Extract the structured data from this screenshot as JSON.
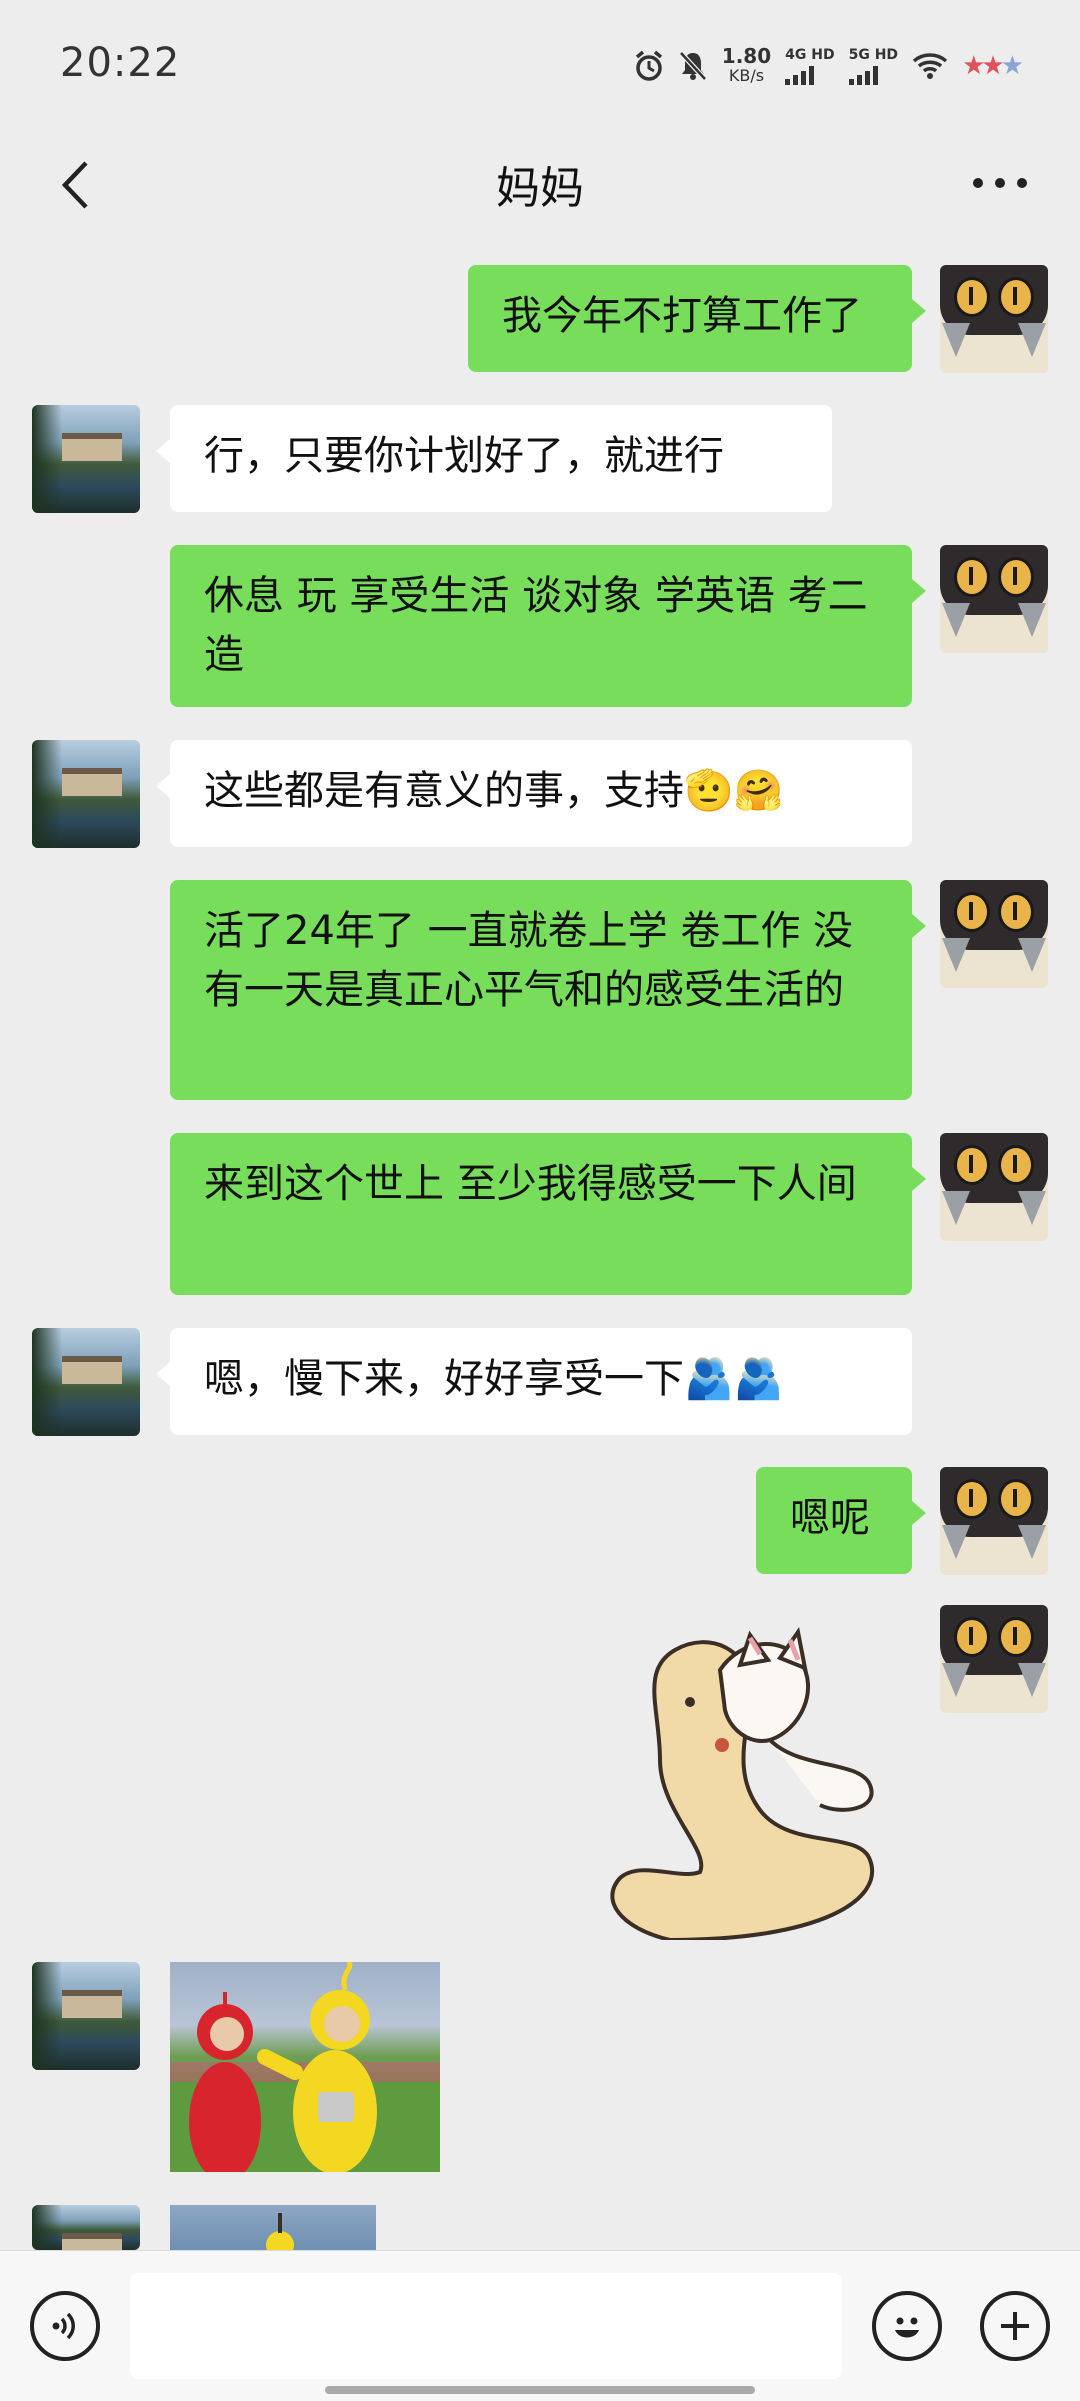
{
  "status_bar": {
    "time": "20:22",
    "net_speed_value": "1.80",
    "net_speed_unit": "KB/s",
    "sim1_label": "4G HD",
    "sim2_label": "5G HD",
    "icons": [
      "alarm-icon",
      "mute-icon",
      "signal-icon",
      "wifi-icon",
      "star-rating-icon"
    ]
  },
  "header": {
    "title": "妈妈",
    "back_icon": "chevron-left-icon",
    "more_icon": "more-dots-icon"
  },
  "messages": [
    {
      "sender": "me",
      "type": "text",
      "text": "我今年不打算工作了"
    },
    {
      "sender": "mom",
      "type": "text",
      "text": "行，只要你计划好了，就进行"
    },
    {
      "sender": "me",
      "type": "text",
      "text": "休息  玩   享受生活   谈对象  学英语   考二造"
    },
    {
      "sender": "mom",
      "type": "text",
      "text": "这些都是有意义的事，支持🫡🤗"
    },
    {
      "sender": "me",
      "type": "text",
      "text": "活了24年了  一直就卷上学 卷工作  没有一天是真正心平气和的感受生活的"
    },
    {
      "sender": "me",
      "type": "text",
      "text": "来到这个世上 至少我得感受一下人间"
    },
    {
      "sender": "mom",
      "type": "text",
      "text": "嗯，慢下来，好好享受一下🫂🫂"
    },
    {
      "sender": "me",
      "type": "text",
      "text": "嗯呢"
    },
    {
      "sender": "me",
      "type": "sticker",
      "sticker": "cat-hugging-weasel-sticker"
    },
    {
      "sender": "mom",
      "type": "image",
      "image": "teletubbies-photo"
    },
    {
      "sender": "mom",
      "type": "image",
      "image": "teletubbies-photo-partial"
    }
  ],
  "input_bar": {
    "voice_icon": "voice-icon",
    "emoji_icon": "emoji-icon",
    "plus_icon": "plus-icon",
    "input_value": ""
  },
  "colors": {
    "background": "#ededed",
    "my_bubble": "#79dd5c",
    "their_bubble": "#ffffff"
  }
}
